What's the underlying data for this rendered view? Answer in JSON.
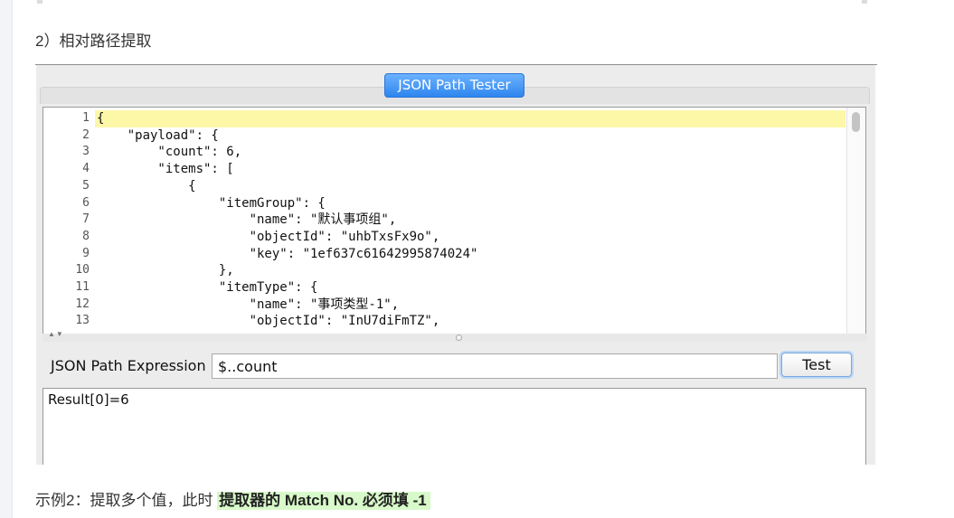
{
  "section_heading": "2）相对路径提取",
  "window": {
    "tab_title": "JSON Path Tester"
  },
  "editor": {
    "line_numbers": [
      "1",
      "2",
      "3",
      "4",
      "5",
      "6",
      "7",
      "8",
      "9",
      "10",
      "11",
      "12",
      "13"
    ],
    "lines": [
      "{",
      "    \"payload\": {",
      "        \"count\": 6,",
      "        \"items\": [",
      "            {",
      "                \"itemGroup\": {",
      "                    \"name\": \"默认事项组\",",
      "                    \"objectId\": \"uhbTxsFx9o\",",
      "                    \"key\": \"1ef637c61642995874024\"",
      "                },",
      "                \"itemType\": {",
      "                    \"name\": \"事项类型-1\",",
      "                    \"objectId\": \"InU7diFmTZ\","
    ],
    "highlight_color": "#fdf7a8"
  },
  "expression": {
    "label": "JSON Path Expression",
    "value": "$..count",
    "test_label": "Test"
  },
  "result": {
    "text": "Result[0]=6"
  },
  "caption": {
    "prefix": "示例2：提取多个值，此时 ",
    "highlight": "提取器的 Match No. 必须填 -1",
    "highlight_color": "#d8f9c9"
  },
  "colors": {
    "accent_tab": "#2f86ee"
  }
}
